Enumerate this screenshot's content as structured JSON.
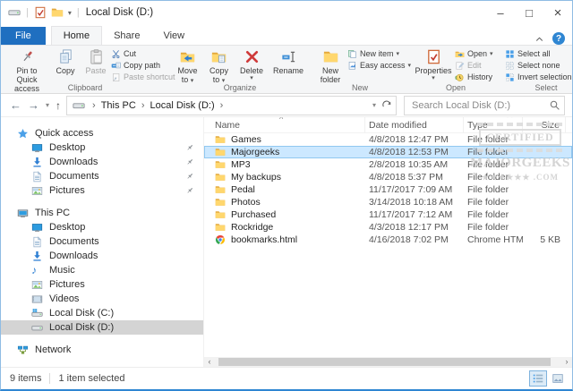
{
  "glyphs": {
    "caret": "▾",
    "back": "←",
    "forward": "→",
    "up": "↑",
    "breadcrumb_sep": "›",
    "help": "?",
    "minimize": "–",
    "maximize": "□",
    "close": "×",
    "scroll_left": "‹",
    "scroll_right": "›",
    "sort_asc": "^",
    "qat_sep": "|"
  },
  "titlebar": {
    "title": "Local Disk (D:)"
  },
  "tabs": {
    "file": "File",
    "home": "Home",
    "share": "Share",
    "view": "View"
  },
  "ribbon": {
    "clipboard": {
      "label": "Clipboard",
      "pin": "Pin to Quick access",
      "copy": "Copy",
      "paste": "Paste",
      "cut": "Cut",
      "copy_path": "Copy path",
      "paste_shortcut": "Paste shortcut"
    },
    "organize": {
      "label": "Organize",
      "move_to": "Move to",
      "copy_to": "Copy to",
      "delete": "Delete",
      "rename": "Rename"
    },
    "new_group": {
      "label": "New",
      "new_folder": "New folder",
      "new_item": "New item",
      "easy_access": "Easy access"
    },
    "open_group": {
      "label": "Open",
      "properties": "Properties",
      "open": "Open",
      "edit": "Edit",
      "history": "History"
    },
    "select_group": {
      "label": "Select",
      "select_all": "Select all",
      "select_none": "Select none",
      "invert": "Invert selection"
    }
  },
  "navbar": {
    "breadcrumb": [
      {
        "label": "This PC"
      },
      {
        "label": "Local Disk (D:)"
      }
    ],
    "search_placeholder": "Search Local Disk (D:)"
  },
  "sidebar": {
    "quick_access_label": "Quick access",
    "quick_items": [
      {
        "label": "Desktop",
        "icon": "monitor",
        "pinned": true
      },
      {
        "label": "Downloads",
        "icon": "download",
        "pinned": true
      },
      {
        "label": "Documents",
        "icon": "document",
        "pinned": true
      },
      {
        "label": "Pictures",
        "icon": "pictures",
        "pinned": true
      }
    ],
    "thispc_label": "This PC",
    "thispc_items": [
      {
        "label": "Desktop",
        "icon": "monitor"
      },
      {
        "label": "Documents",
        "icon": "document"
      },
      {
        "label": "Downloads",
        "icon": "download"
      },
      {
        "label": "Music",
        "icon": "music"
      },
      {
        "label": "Pictures",
        "icon": "pictures"
      },
      {
        "label": "Videos",
        "icon": "videos"
      },
      {
        "label": "Local Disk (C:)",
        "icon": "drive_sys"
      },
      {
        "label": "Local Disk (D:)",
        "icon": "drive",
        "selected": true
      }
    ],
    "network_label": "Network"
  },
  "filelist": {
    "columns": [
      "Name",
      "Date modified",
      "Type",
      "Size"
    ],
    "rows": [
      {
        "name": "Games",
        "icon": "folder",
        "date": "4/8/2018 12:47 PM",
        "type": "File folder",
        "size": ""
      },
      {
        "name": "Majorgeeks",
        "icon": "folder",
        "date": "4/8/2018 12:53 PM",
        "type": "File folder",
        "size": "",
        "selected": true
      },
      {
        "name": "MP3",
        "icon": "folder",
        "date": "2/8/2018 10:35 AM",
        "type": "File folder",
        "size": ""
      },
      {
        "name": "My backups",
        "icon": "folder",
        "date": "4/8/2018 5:37 PM",
        "type": "File folder",
        "size": ""
      },
      {
        "name": "Pedal",
        "icon": "folder",
        "date": "11/17/2017 7:09 AM",
        "type": "File folder",
        "size": ""
      },
      {
        "name": "Photos",
        "icon": "folder",
        "date": "3/14/2018 10:18 AM",
        "type": "File folder",
        "size": ""
      },
      {
        "name": "Purchased",
        "icon": "folder",
        "date": "11/17/2017 7:12 AM",
        "type": "File folder",
        "size": ""
      },
      {
        "name": "Rockridge",
        "icon": "folder",
        "date": "4/3/2018 12:17 PM",
        "type": "File folder",
        "size": ""
      },
      {
        "name": "bookmarks.html",
        "icon": "chrome",
        "date": "4/16/2018 7:02 PM",
        "type": "Chrome HTML Do...",
        "size": "5 KB"
      }
    ]
  },
  "statusbar": {
    "items": "9 items",
    "selected": "1 item selected"
  },
  "watermark": {
    "line1": "TESTED ★ 100% CLEAN",
    "line2": "CERTIFIED",
    "line3": "MAJORGEEKS",
    "line4": "★★★★★★ .COM"
  },
  "colors": {
    "accent": "#1f6fc0",
    "selection": "#cce8ff",
    "sidebar_selection": "#d4d4d4"
  }
}
